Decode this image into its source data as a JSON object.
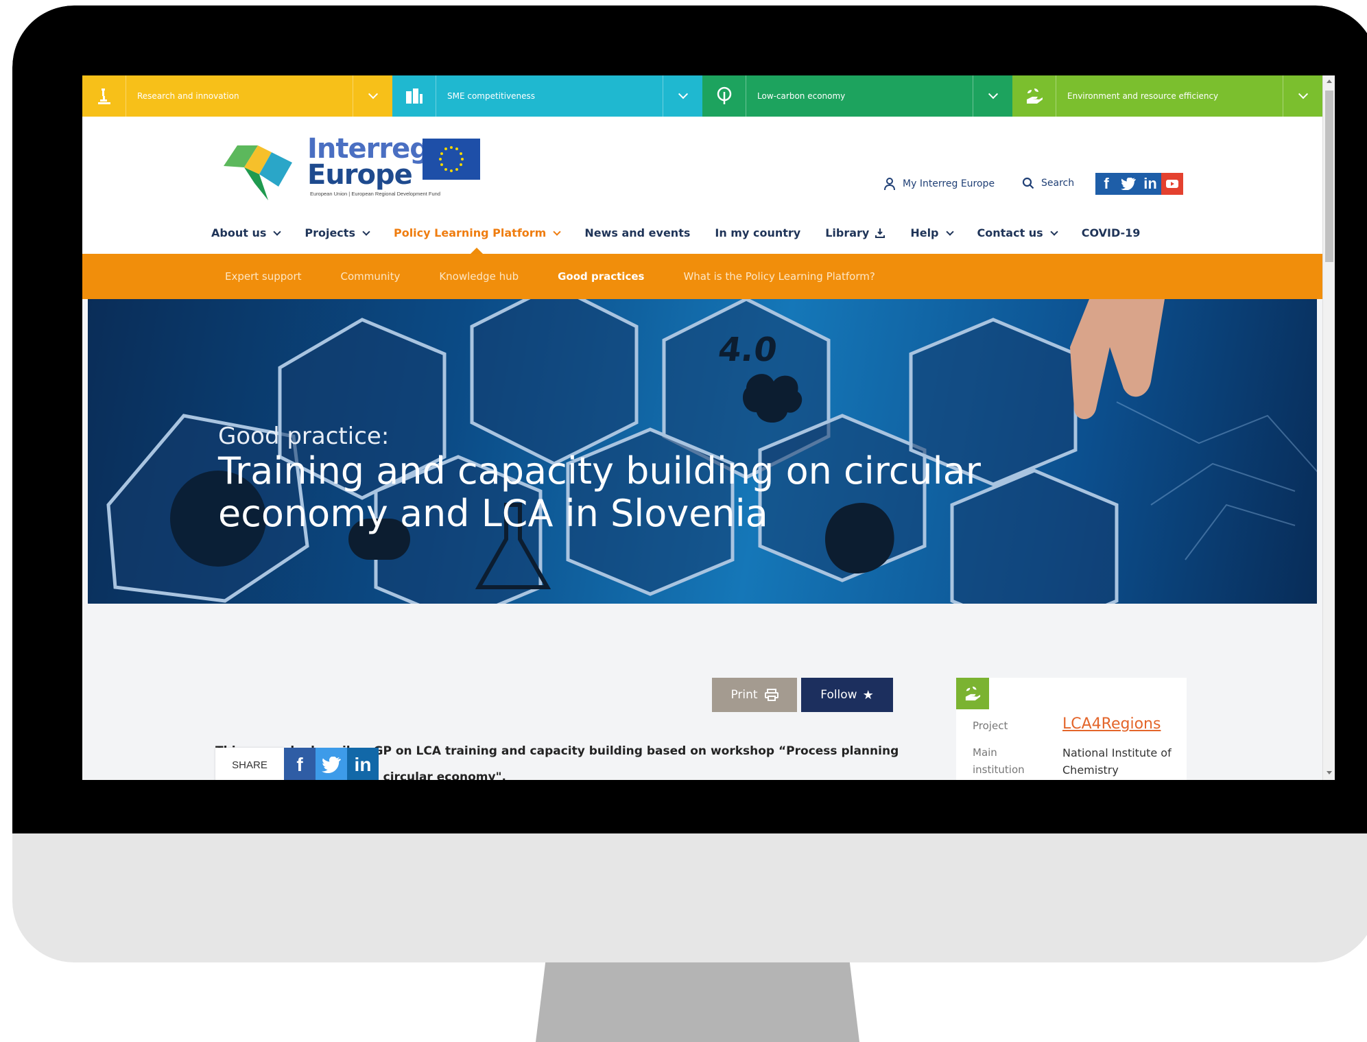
{
  "theme_bar": [
    {
      "label": "Research and innovation",
      "icon": "microscope-icon",
      "color": "#f7c019"
    },
    {
      "label": "SME competitiveness",
      "icon": "buildings-icon",
      "color": "#1fb8d0"
    },
    {
      "label": "Low-carbon economy",
      "icon": "tree-icon",
      "color": "#1da35e"
    },
    {
      "label": "Environment and resource efficiency",
      "icon": "hand-plant-icon",
      "color": "#7bbf2e"
    }
  ],
  "logo": {
    "line1": "Interreg",
    "line2": "Europe",
    "subtitle": "European Union | European Regional Development Fund"
  },
  "header": {
    "my_interreg": "My Interreg Europe",
    "search": "Search"
  },
  "main_nav": [
    {
      "label": "About us",
      "has_dropdown": true
    },
    {
      "label": "Projects",
      "has_dropdown": true
    },
    {
      "label": "Policy Learning Platform",
      "has_dropdown": true,
      "active": true
    },
    {
      "label": "News and events",
      "has_dropdown": false
    },
    {
      "label": "In my country",
      "has_dropdown": false
    },
    {
      "label": "Library",
      "has_dropdown": false
    },
    {
      "label": "Help",
      "has_dropdown": true
    },
    {
      "label": "Contact us",
      "has_dropdown": true
    },
    {
      "label": "COVID-19",
      "has_dropdown": false
    }
  ],
  "sub_nav": [
    {
      "label": "Expert support"
    },
    {
      "label": "Community"
    },
    {
      "label": "Knowledge hub"
    },
    {
      "label": "Good practices",
      "active": true
    },
    {
      "label": "What is the Policy Learning Platform?"
    }
  ],
  "hero": {
    "kicker": "Good practice:",
    "title": "Training and capacity building on circular economy and LCA in Slovenia"
  },
  "actions": {
    "print": "Print",
    "follow": "Follow"
  },
  "intro_text": "This example describes GP on LCA training and capacity building based on workshop “Process planning and decision making in a circular economy\".",
  "share": {
    "label": "SHARE"
  },
  "side_card": {
    "project_label": "Project",
    "project_value": "LCA4Regions",
    "institution_label_1": "Main",
    "institution_label_2": "institution",
    "institution_value": "National Institute of Chemistry"
  },
  "colors": {
    "accent_orange": "#f18e0b",
    "navy": "#1c2f5e"
  }
}
